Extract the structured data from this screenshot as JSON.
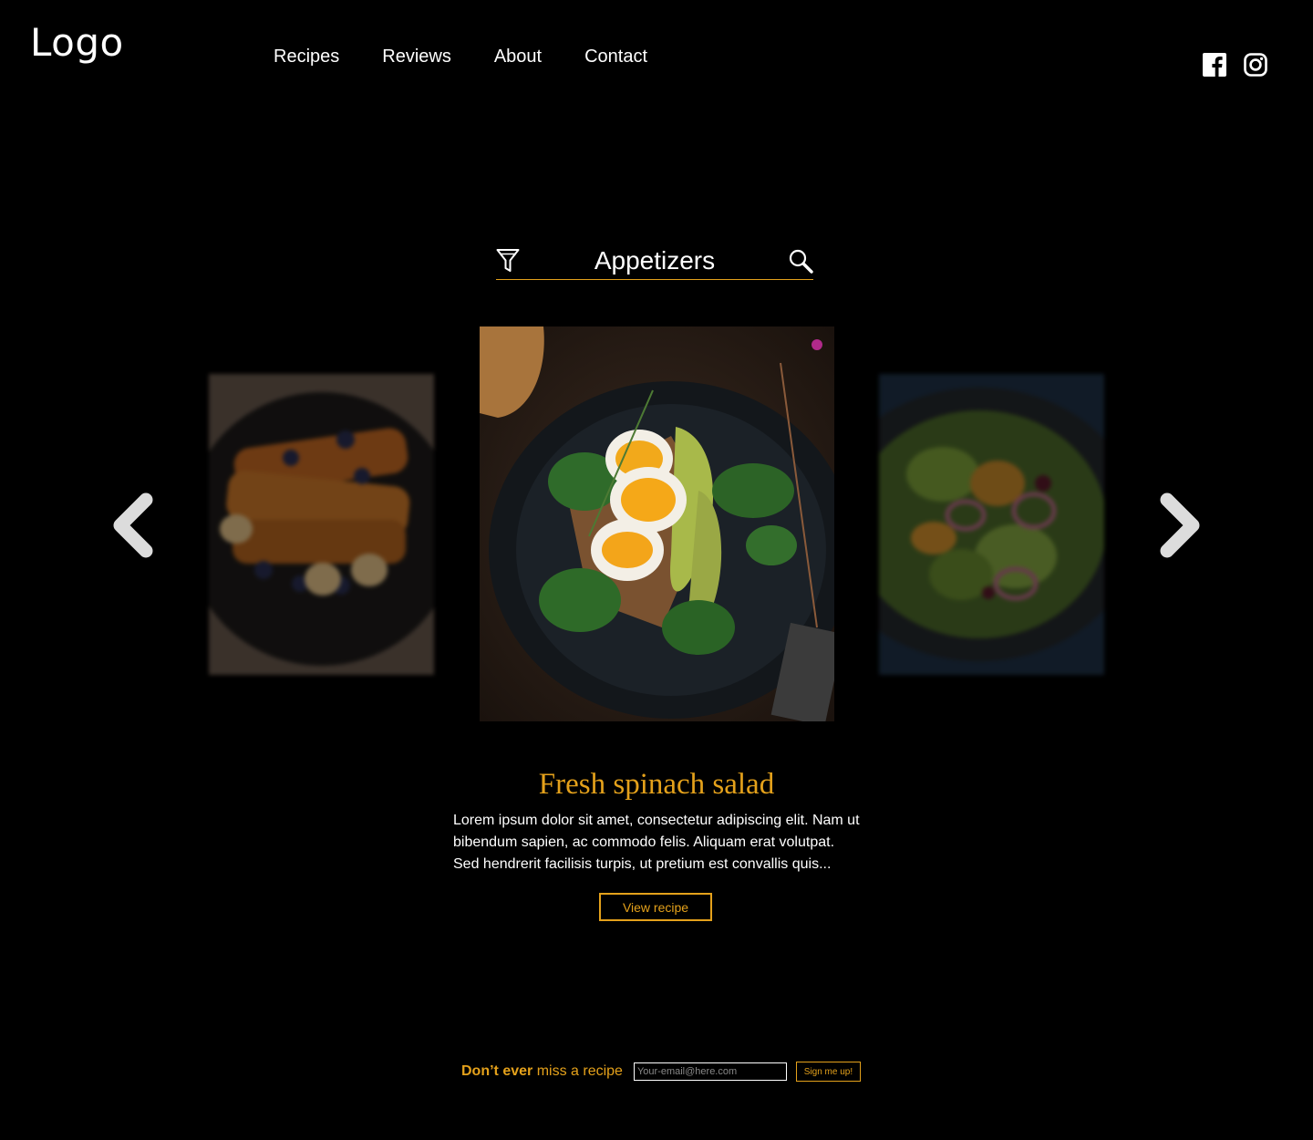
{
  "header": {
    "logo": "Logo",
    "nav": [
      "Recipes",
      "Reviews",
      "About",
      "Contact"
    ],
    "social": [
      "facebook-icon",
      "instagram-icon"
    ]
  },
  "filter": {
    "category": "Appetizers",
    "filter_icon": "filter-funnel-icon",
    "search_icon": "search-icon"
  },
  "carousel": {
    "prev_icon": "chevron-left-icon",
    "next_icon": "chevron-right-icon",
    "slides": [
      "french toast with blueberries and bananas",
      "egg and avocado toast on spinach",
      "mixed salad with red onion"
    ]
  },
  "featured": {
    "title": "Fresh spinach salad",
    "description": "Lorem ipsum dolor sit amet, consectetur adipiscing elit. Nam ut bibendum sapien, ac commodo felis. Aliquam erat volutpat. Sed hendrerit facilisis turpis, ut pretium est convallis quis...",
    "button": "View recipe"
  },
  "newsletter": {
    "lead_bold": "Don’t ever",
    "lead_rest": " miss a recipe",
    "placeholder": "Your-email@here.com",
    "button": "Sign me up!"
  },
  "colors": {
    "accent": "#e4a11b",
    "background": "#000000",
    "text": "#ffffff"
  }
}
